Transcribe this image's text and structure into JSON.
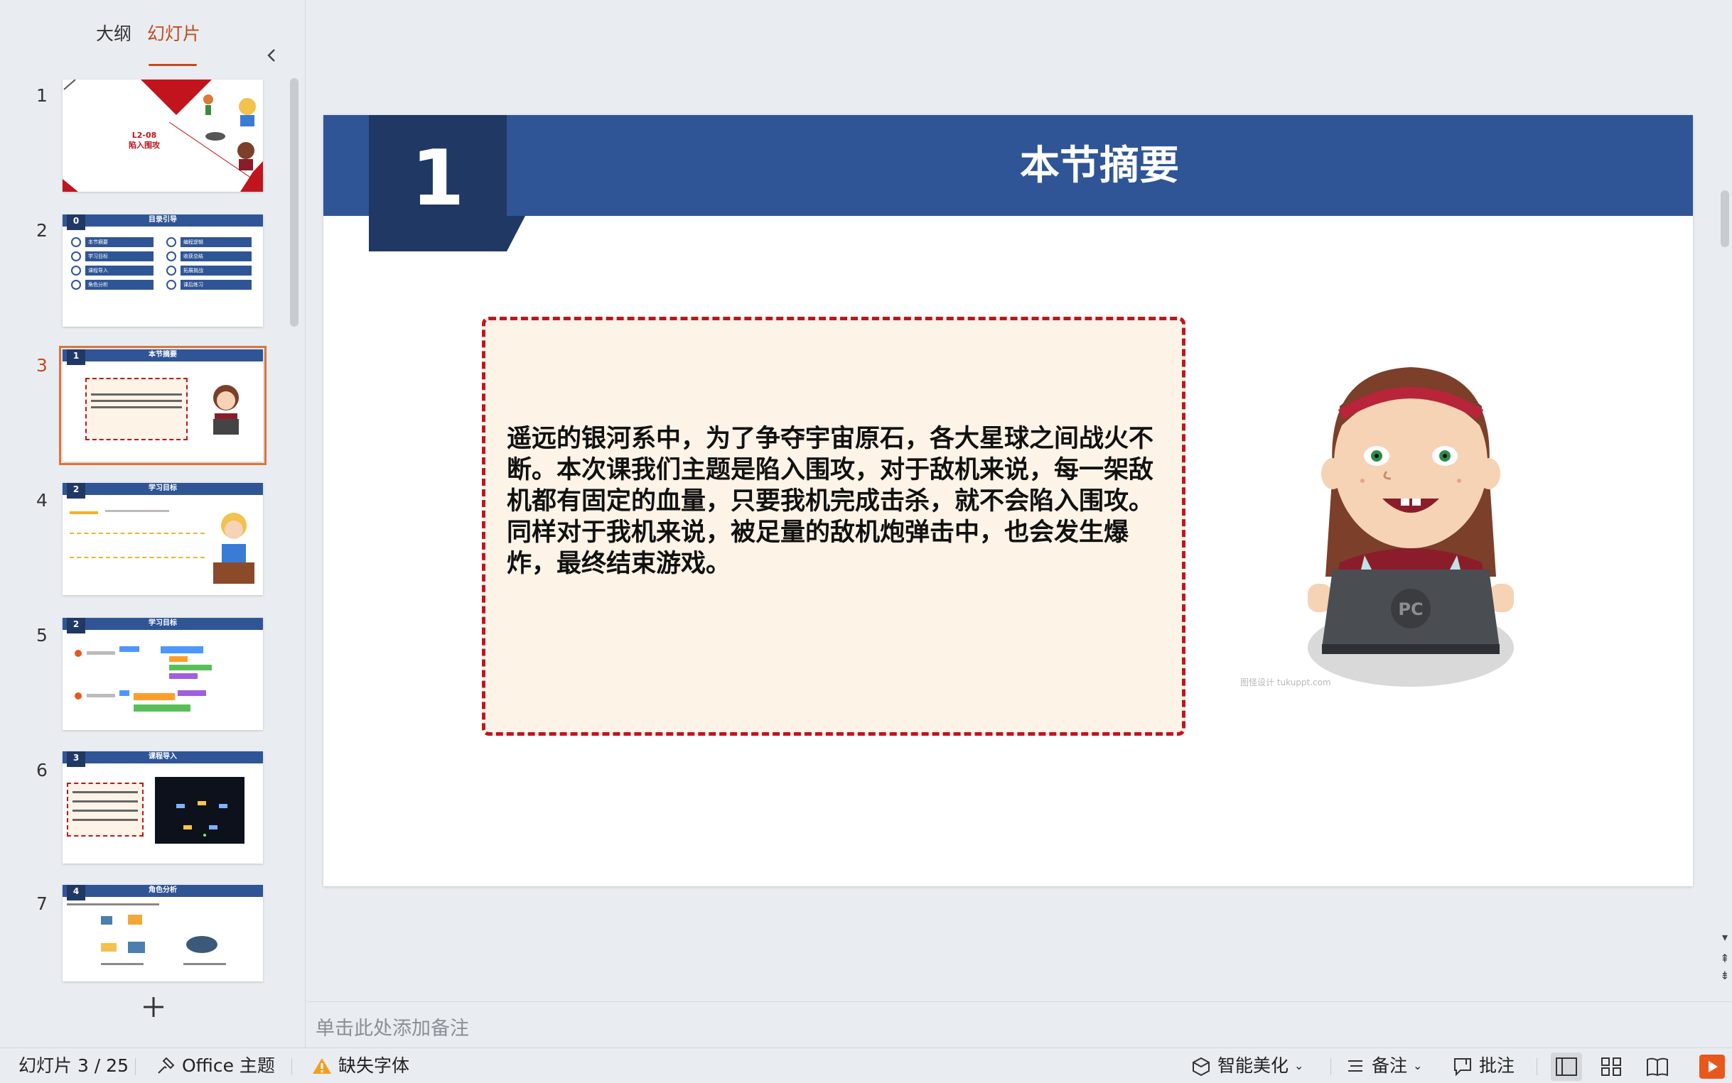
{
  "panel": {
    "tab_outline": "大纲",
    "tab_slides": "幻灯片",
    "active_tab": "幻灯片"
  },
  "thumbnails": [
    {
      "num": "1",
      "title_line1": "L2-08",
      "title_line2": "陷入围攻"
    },
    {
      "num": "2",
      "bar_num": "0",
      "title": "目录引导",
      "items_left": [
        "本节摘要",
        "学习目标",
        "课程导入",
        "角色分析"
      ],
      "items_right": [
        "编程逻辑",
        "收获总结",
        "拓展挑战",
        "课后练习"
      ]
    },
    {
      "num": "3",
      "bar_num": "1",
      "title": "本节摘要"
    },
    {
      "num": "4",
      "bar_num": "2",
      "title": "学习目标"
    },
    {
      "num": "5",
      "bar_num": "2",
      "title": "学习目标"
    },
    {
      "num": "6",
      "bar_num": "3",
      "title": "课程导入"
    },
    {
      "num": "7",
      "bar_num": "4",
      "title": "角色分析"
    }
  ],
  "active_slide_index": 3,
  "slide": {
    "number": "1",
    "title": "本节摘要",
    "summary": "遥远的银河系中，为了争夺宇宙原石，各大星球之间战火不断。本次课我们主题是陷入围攻，对于敌机来说，每一架敌机都有固定的血量，只要我机完成击杀，就不会陷入围攻。同样对于我机来说，被足量的敌机炮弹击中，也会发生爆炸，最终结束游戏。",
    "laptop_label": "PC",
    "watermark": "图怪设计 tukuppt.com"
  },
  "notes": {
    "placeholder": "单击此处添加备注"
  },
  "status_bar": {
    "slide_counter": "幻灯片 3 / 25",
    "theme": "Office 主题",
    "missing_fonts": "缺失字体",
    "smart_beautify": "智能美化",
    "notes_label": "备注",
    "comments_label": "批注"
  },
  "colors": {
    "accent": "#c44a1c",
    "slide_header": "#2f5596",
    "slide_num_box": "#203864",
    "dashed_border": "#c0151d",
    "box_fill": "#fdf3e7",
    "play_button": "#e8581c"
  },
  "icons": [
    "chevron-left-icon",
    "plus-icon",
    "theme-icon",
    "warning-icon",
    "beautify-icon",
    "notes-icon",
    "comment-icon",
    "normal-view-icon",
    "grid-view-icon",
    "reading-view-icon",
    "play-icon"
  ]
}
